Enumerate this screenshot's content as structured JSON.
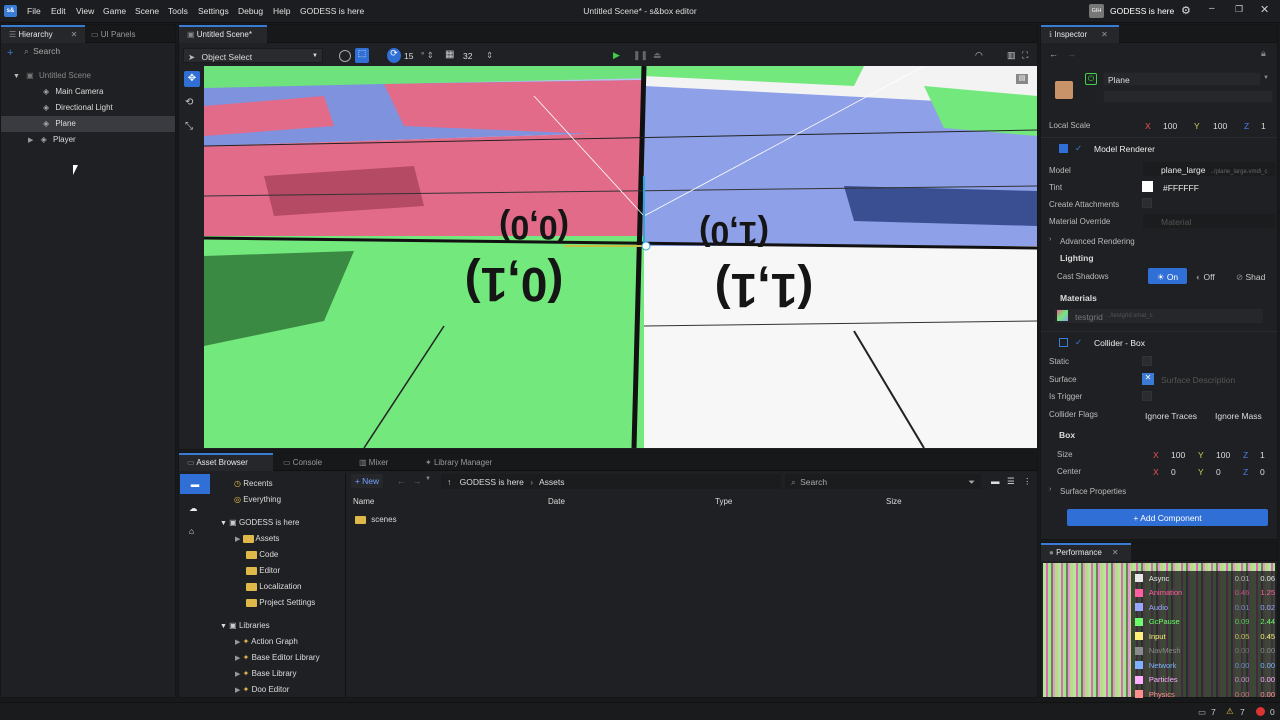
{
  "menubar": {
    "logo": "s&",
    "items": [
      "File",
      "Edit",
      "View",
      "Game",
      "Scene",
      "Tools",
      "Settings",
      "Debug",
      "Help",
      "GODESS is here"
    ],
    "window_title": "Untitled Scene* - s&box editor",
    "user_badge": "GIH",
    "user_name": "GODESS is here"
  },
  "hierarchy": {
    "tabs": [
      "Hierarchy",
      "UI Panels"
    ],
    "search_placeholder": "Search",
    "root": "Untitled Scene",
    "items": [
      "Main Camera",
      "Directional Light",
      "Plane",
      "Player"
    ]
  },
  "scene": {
    "tab": "Untitled Scene*",
    "tool_mode": "Object Select",
    "snap_value": "15",
    "grid_value": "32",
    "floor_labels": [
      "(0,0)",
      "(1,0)",
      "(0,1)",
      "(1,1)"
    ]
  },
  "inspector": {
    "tab": "Inspector",
    "object_name": "Plane",
    "local_scale_label": "Local Scale",
    "scale": {
      "x": "100",
      "y": "100",
      "z": "1"
    },
    "model_renderer": "Model Renderer",
    "model_label": "Model",
    "model_value": "plane_large",
    "model_path": "../plane_large.vmdl_c",
    "tint_label": "Tint",
    "tint_value": "#FFFFFF",
    "create_attachments": "Create Attachments",
    "material_override": "Material Override",
    "material_placeholder": "Material",
    "advanced_rendering": "Advanced Rendering",
    "lighting": "Lighting",
    "cast_shadows": "Cast Shadows",
    "shadow_opts": [
      "On",
      "Off",
      "Shad"
    ],
    "materials": "Materials",
    "material_name": "testgrid",
    "material_path": "../testgrid.vmat_c",
    "collider": "Collider - Box",
    "static": "Static",
    "surface": "Surface",
    "surface_placeholder": "Surface Description",
    "is_trigger": "Is Trigger",
    "collider_flags": "Collider Flags",
    "flags": [
      "Ignore Traces",
      "Ignore Mass"
    ],
    "box": "Box",
    "size_label": "Size",
    "size": {
      "x": "100",
      "y": "100",
      "z": "1"
    },
    "center_label": "Center",
    "center": {
      "x": "0",
      "y": "0",
      "z": "0"
    },
    "surface_properties": "Surface Properties",
    "add_component": "Add Component"
  },
  "performance": {
    "tab": "Performance",
    "rows": [
      {
        "name": "Async",
        "a": "0.01",
        "b": "0.06",
        "color": "#e8e8e8"
      },
      {
        "name": "Animation",
        "a": "0.46",
        "b": "1.25",
        "color": "#ff5fa0"
      },
      {
        "name": "Audio",
        "a": "0.01",
        "b": "0.02",
        "color": "#9aa7ff"
      },
      {
        "name": "GcPause",
        "a": "0.09",
        "b": "2.44",
        "color": "#6bff6b"
      },
      {
        "name": "Input",
        "a": "0.05",
        "b": "0.45",
        "color": "#fff27a"
      },
      {
        "name": "NavMesh",
        "a": "0.00",
        "b": "0.00",
        "color": "#8a8a8a"
      },
      {
        "name": "Network",
        "a": "0.00",
        "b": "0.00",
        "color": "#7fb0ff"
      },
      {
        "name": "Particles",
        "a": "0.00",
        "b": "0.00",
        "color": "#ffb0ff"
      },
      {
        "name": "Physics",
        "a": "0.00",
        "b": "0.00",
        "color": "#ff8f8f"
      }
    ]
  },
  "assets": {
    "tabs": [
      "Asset Browser",
      "Console",
      "Mixer",
      "Library Manager"
    ],
    "quick": [
      "Recents",
      "Everything"
    ],
    "project": "GODESS is here",
    "project_folders": [
      "Assets",
      "Code",
      "Editor",
      "Localization",
      "Project Settings"
    ],
    "libraries": "Libraries",
    "library_items": [
      "Action Graph",
      "Base Editor Library",
      "Base Library",
      "Doo Editor"
    ],
    "new_label": "New",
    "breadcrumb": [
      "GODESS is here",
      "Assets"
    ],
    "search_placeholder": "Search",
    "columns": [
      "Name",
      "Date",
      "Type",
      "Size"
    ],
    "files": [
      "scenes"
    ]
  },
  "status": {
    "a": "7",
    "b": "7",
    "c": "0"
  }
}
